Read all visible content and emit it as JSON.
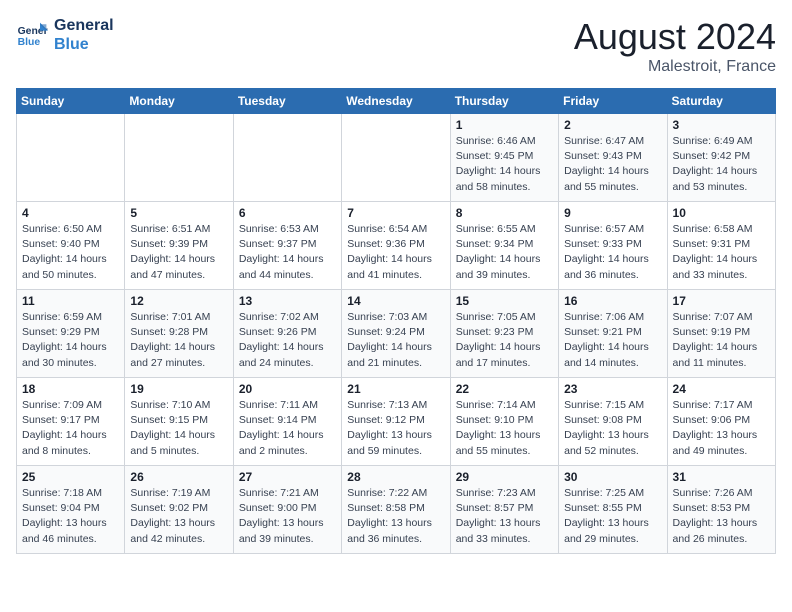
{
  "header": {
    "logo_line1": "General",
    "logo_line2": "Blue",
    "title": "August 2024",
    "subtitle": "Malestroit, France"
  },
  "days_of_week": [
    "Sunday",
    "Monday",
    "Tuesday",
    "Wednesday",
    "Thursday",
    "Friday",
    "Saturday"
  ],
  "weeks": [
    [
      {
        "day": "",
        "info": ""
      },
      {
        "day": "",
        "info": ""
      },
      {
        "day": "",
        "info": ""
      },
      {
        "day": "",
        "info": ""
      },
      {
        "day": "1",
        "info": "Sunrise: 6:46 AM\nSunset: 9:45 PM\nDaylight: 14 hours\nand 58 minutes."
      },
      {
        "day": "2",
        "info": "Sunrise: 6:47 AM\nSunset: 9:43 PM\nDaylight: 14 hours\nand 55 minutes."
      },
      {
        "day": "3",
        "info": "Sunrise: 6:49 AM\nSunset: 9:42 PM\nDaylight: 14 hours\nand 53 minutes."
      }
    ],
    [
      {
        "day": "4",
        "info": "Sunrise: 6:50 AM\nSunset: 9:40 PM\nDaylight: 14 hours\nand 50 minutes."
      },
      {
        "day": "5",
        "info": "Sunrise: 6:51 AM\nSunset: 9:39 PM\nDaylight: 14 hours\nand 47 minutes."
      },
      {
        "day": "6",
        "info": "Sunrise: 6:53 AM\nSunset: 9:37 PM\nDaylight: 14 hours\nand 44 minutes."
      },
      {
        "day": "7",
        "info": "Sunrise: 6:54 AM\nSunset: 9:36 PM\nDaylight: 14 hours\nand 41 minutes."
      },
      {
        "day": "8",
        "info": "Sunrise: 6:55 AM\nSunset: 9:34 PM\nDaylight: 14 hours\nand 39 minutes."
      },
      {
        "day": "9",
        "info": "Sunrise: 6:57 AM\nSunset: 9:33 PM\nDaylight: 14 hours\nand 36 minutes."
      },
      {
        "day": "10",
        "info": "Sunrise: 6:58 AM\nSunset: 9:31 PM\nDaylight: 14 hours\nand 33 minutes."
      }
    ],
    [
      {
        "day": "11",
        "info": "Sunrise: 6:59 AM\nSunset: 9:29 PM\nDaylight: 14 hours\nand 30 minutes."
      },
      {
        "day": "12",
        "info": "Sunrise: 7:01 AM\nSunset: 9:28 PM\nDaylight: 14 hours\nand 27 minutes."
      },
      {
        "day": "13",
        "info": "Sunrise: 7:02 AM\nSunset: 9:26 PM\nDaylight: 14 hours\nand 24 minutes."
      },
      {
        "day": "14",
        "info": "Sunrise: 7:03 AM\nSunset: 9:24 PM\nDaylight: 14 hours\nand 21 minutes."
      },
      {
        "day": "15",
        "info": "Sunrise: 7:05 AM\nSunset: 9:23 PM\nDaylight: 14 hours\nand 17 minutes."
      },
      {
        "day": "16",
        "info": "Sunrise: 7:06 AM\nSunset: 9:21 PM\nDaylight: 14 hours\nand 14 minutes."
      },
      {
        "day": "17",
        "info": "Sunrise: 7:07 AM\nSunset: 9:19 PM\nDaylight: 14 hours\nand 11 minutes."
      }
    ],
    [
      {
        "day": "18",
        "info": "Sunrise: 7:09 AM\nSunset: 9:17 PM\nDaylight: 14 hours\nand 8 minutes."
      },
      {
        "day": "19",
        "info": "Sunrise: 7:10 AM\nSunset: 9:15 PM\nDaylight: 14 hours\nand 5 minutes."
      },
      {
        "day": "20",
        "info": "Sunrise: 7:11 AM\nSunset: 9:14 PM\nDaylight: 14 hours\nand 2 minutes."
      },
      {
        "day": "21",
        "info": "Sunrise: 7:13 AM\nSunset: 9:12 PM\nDaylight: 13 hours\nand 59 minutes."
      },
      {
        "day": "22",
        "info": "Sunrise: 7:14 AM\nSunset: 9:10 PM\nDaylight: 13 hours\nand 55 minutes."
      },
      {
        "day": "23",
        "info": "Sunrise: 7:15 AM\nSunset: 9:08 PM\nDaylight: 13 hours\nand 52 minutes."
      },
      {
        "day": "24",
        "info": "Sunrise: 7:17 AM\nSunset: 9:06 PM\nDaylight: 13 hours\nand 49 minutes."
      }
    ],
    [
      {
        "day": "25",
        "info": "Sunrise: 7:18 AM\nSunset: 9:04 PM\nDaylight: 13 hours\nand 46 minutes."
      },
      {
        "day": "26",
        "info": "Sunrise: 7:19 AM\nSunset: 9:02 PM\nDaylight: 13 hours\nand 42 minutes."
      },
      {
        "day": "27",
        "info": "Sunrise: 7:21 AM\nSunset: 9:00 PM\nDaylight: 13 hours\nand 39 minutes."
      },
      {
        "day": "28",
        "info": "Sunrise: 7:22 AM\nSunset: 8:58 PM\nDaylight: 13 hours\nand 36 minutes."
      },
      {
        "day": "29",
        "info": "Sunrise: 7:23 AM\nSunset: 8:57 PM\nDaylight: 13 hours\nand 33 minutes."
      },
      {
        "day": "30",
        "info": "Sunrise: 7:25 AM\nSunset: 8:55 PM\nDaylight: 13 hours\nand 29 minutes."
      },
      {
        "day": "31",
        "info": "Sunrise: 7:26 AM\nSunset: 8:53 PM\nDaylight: 13 hours\nand 26 minutes."
      }
    ]
  ]
}
